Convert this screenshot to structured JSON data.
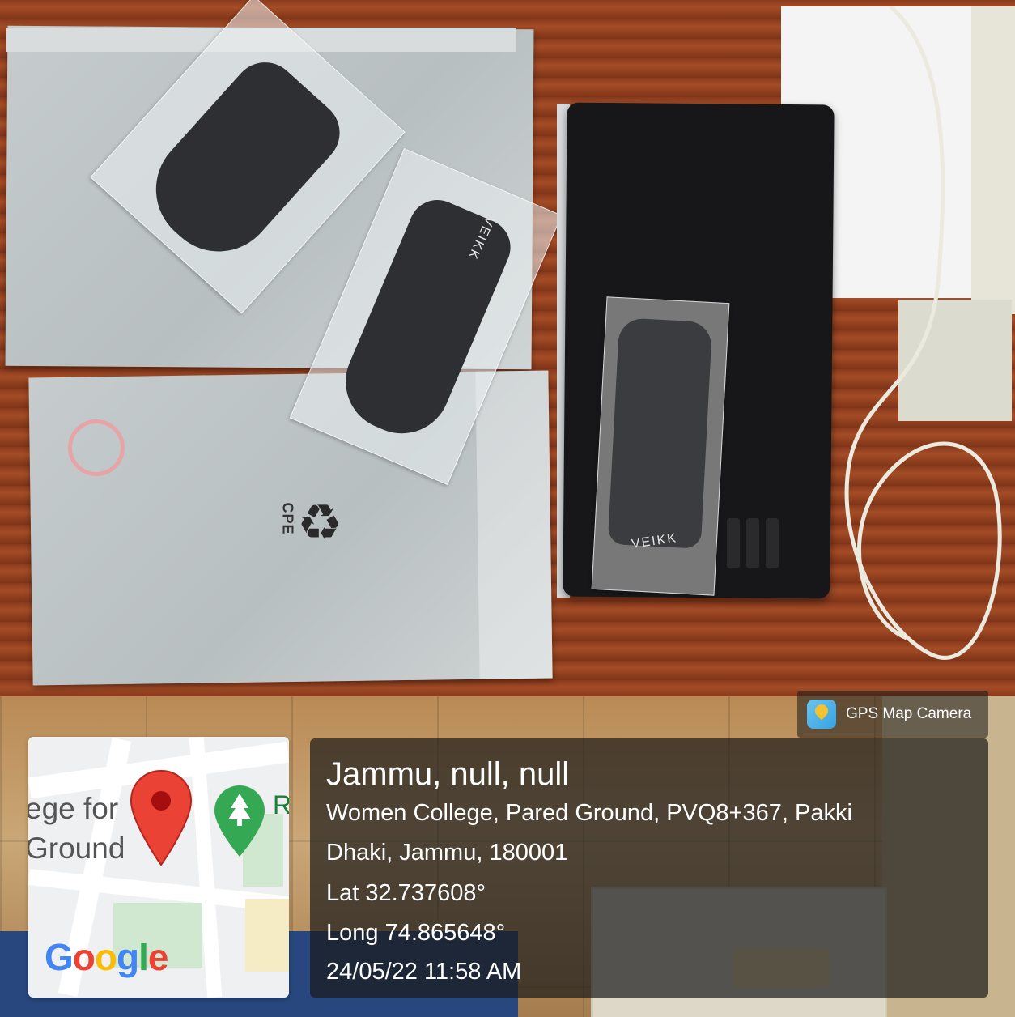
{
  "photo": {
    "objects": {
      "gloves_brand_1": "VEIKK",
      "gloves_brand_2": "VEIKK",
      "box_label": "CPE",
      "recycle_symbol": "♻"
    }
  },
  "gps_badge": {
    "app_name": "GPS Map Camera",
    "icon": "gps-map-camera-icon"
  },
  "map_card": {
    "label_line_1": "ege for",
    "label_line_2": "Ground",
    "label_right": "R",
    "pin_icon": "map-pin-icon",
    "park_icon": "park-tree-icon",
    "logo": {
      "letters": [
        "G",
        "o",
        "o",
        "g",
        "l",
        "e"
      ],
      "colors": [
        "#4285f4",
        "#ea4335",
        "#fbbc05",
        "#4285f4",
        "#34a853",
        "#ea4335"
      ]
    }
  },
  "info_card": {
    "title": "Jammu, null, null",
    "address_line_1": "Women College, Pared Ground, PVQ8+367, Pakki",
    "address_line_2": "Dhaki, Jammu, 180001",
    "latitude": "Lat 32.737608°",
    "longitude": "Long 74.865648°",
    "datetime": "24/05/22 11:58 AM"
  },
  "colors": {
    "overlay_background": "#191919",
    "text": "#ffffff",
    "map_pin": "#ea4335",
    "park_icon": "#34a853"
  }
}
